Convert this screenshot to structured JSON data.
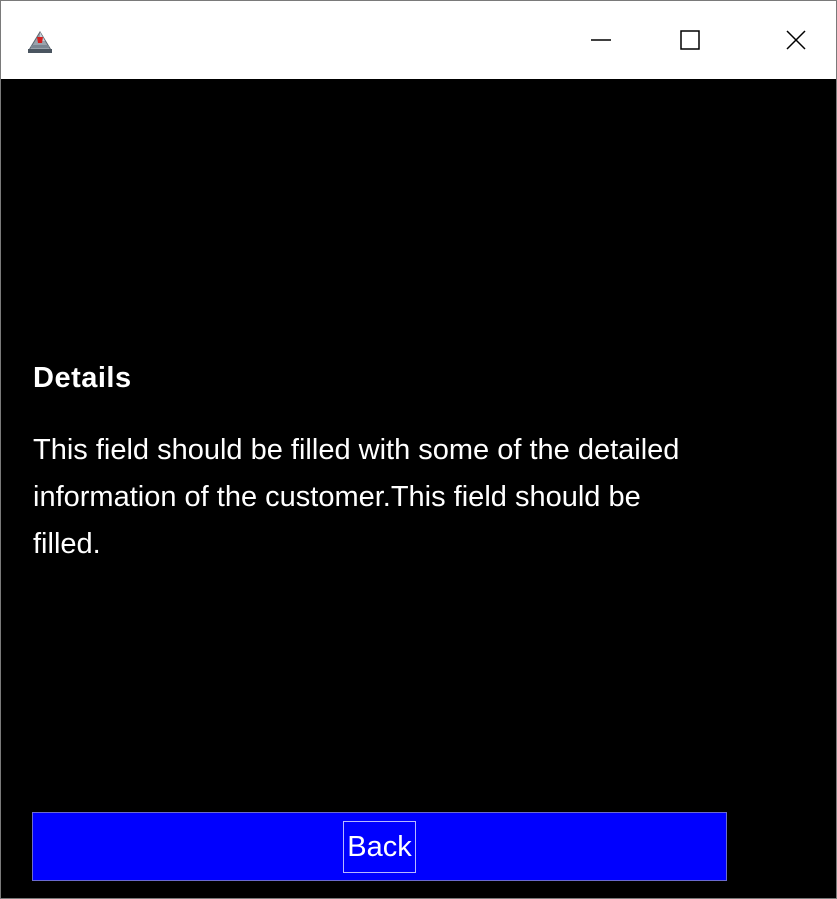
{
  "window": {
    "icon": "java-app-icon",
    "controls": {
      "minimize_icon": "minimize-icon",
      "maximize_icon": "maximize-icon",
      "close_icon": "close-icon"
    }
  },
  "content": {
    "title": "Details",
    "description": "This field should be filled with some of the detailed information of the customer.This field should be filled.",
    "background_color": "#000000",
    "text_color": "#ffffff"
  },
  "actions": {
    "back_label": "Back",
    "back_color": "#0000ff"
  }
}
